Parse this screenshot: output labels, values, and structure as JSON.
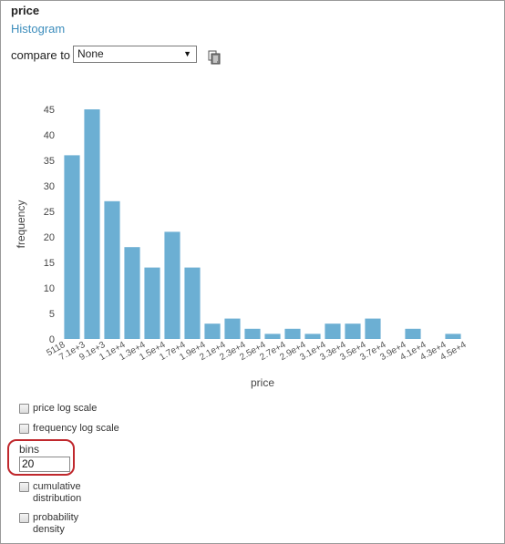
{
  "header": {
    "title": "price",
    "subtitle": "Histogram"
  },
  "compare": {
    "label": "compare to",
    "selected": "None"
  },
  "icons": {
    "copy": "copy-icon",
    "dropdown": "chevron-down-icon"
  },
  "chart_data": {
    "type": "bar",
    "xlabel": "price",
    "ylabel": "frequency",
    "categories": [
      "5118",
      "7.1e+3",
      "9.1e+3",
      "1.1e+4",
      "1.3e+4",
      "1.5e+4",
      "1.7e+4",
      "1.9e+4",
      "2.1e+4",
      "2.3e+4",
      "2.5e+4",
      "2.7e+4",
      "2.9e+4",
      "3.1e+4",
      "3.3e+4",
      "3.5e+4",
      "3.7e+4",
      "3.9e+4",
      "4.1e+4",
      "4.3e+4",
      "4.5e+4"
    ],
    "values": [
      36,
      45,
      27,
      18,
      14,
      21,
      14,
      3,
      4,
      2,
      1,
      2,
      1,
      3,
      3,
      4,
      0,
      2,
      0,
      1
    ],
    "yticks": [
      0,
      5,
      10,
      15,
      20,
      25,
      30,
      35,
      40,
      45
    ],
    "ylim": [
      0,
      45
    ],
    "bar_color": "#6cafd3",
    "grid": false
  },
  "options": {
    "price_log_scale": "price log scale",
    "frequency_log_scale": "frequency log scale",
    "bins_label": "bins",
    "bins_value": "20",
    "cumulative_line1": "cumulative",
    "cumulative_line2": "distribution",
    "probability_line1": "probability",
    "probability_line2": "density"
  },
  "colors": {
    "accent": "#3c8dbc",
    "highlight": "#c0282d"
  }
}
